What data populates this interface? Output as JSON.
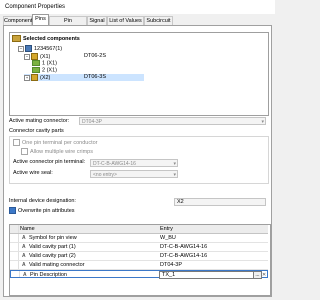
{
  "window": {
    "title": "Component Properties"
  },
  "tabs": [
    {
      "label": "Component"
    },
    {
      "label": "Pins"
    },
    {
      "label": "Pin Assignment"
    },
    {
      "label": "Signal"
    },
    {
      "label": "List of Values"
    },
    {
      "label": "Subcircuit"
    }
  ],
  "tree": {
    "header": "Selected components",
    "nodes": [
      {
        "label": "1234567(1)",
        "value": ""
      },
      {
        "label": "(X1)",
        "value": "DT06-2S"
      },
      {
        "label": "1 (X1)",
        "value": ""
      },
      {
        "label": "2 (X1)",
        "value": ""
      },
      {
        "label": "(X2)",
        "value": "DT06-3S"
      }
    ]
  },
  "form": {
    "active_mating_connector_label": "Active mating connector:",
    "active_mating_connector_value": "DT04-3P",
    "cavity_parts_label": "Connector cavity parts",
    "one_pin_label": "One pin terminal per conductor",
    "allow_multi_label": "Allow multiple wire crimps",
    "active_pin_terminal_label": "Active connector pin terminal:",
    "active_pin_terminal_value": "DT-C-B-AWG14-16",
    "active_wire_seal_label": "Active wire seal:",
    "active_wire_seal_value": "<no entry>",
    "internal_device_label": "Internal device designation:",
    "internal_device_value": "X2",
    "overwrite_label": "Overwrite pin attributes"
  },
  "grid": {
    "headers": [
      "Name",
      "Entry"
    ],
    "rows": [
      {
        "name": "Symbol for pin view",
        "entry": "W_BU"
      },
      {
        "name": "Valid cavity part (1)",
        "entry": "DT-C-B-AWG14-16"
      },
      {
        "name": "Valid cavity part (2)",
        "entry": "DT-C-B-AWG14-16"
      },
      {
        "name": "Valid mating connector",
        "entry": "DT04-3P"
      },
      {
        "name": "Pin Description",
        "entry": "TX_1"
      }
    ],
    "edit_button": "...",
    "clear_button": "✕"
  },
  "icons": {
    "collapse": "−",
    "attribute": "A",
    "dropdown": "▾"
  }
}
